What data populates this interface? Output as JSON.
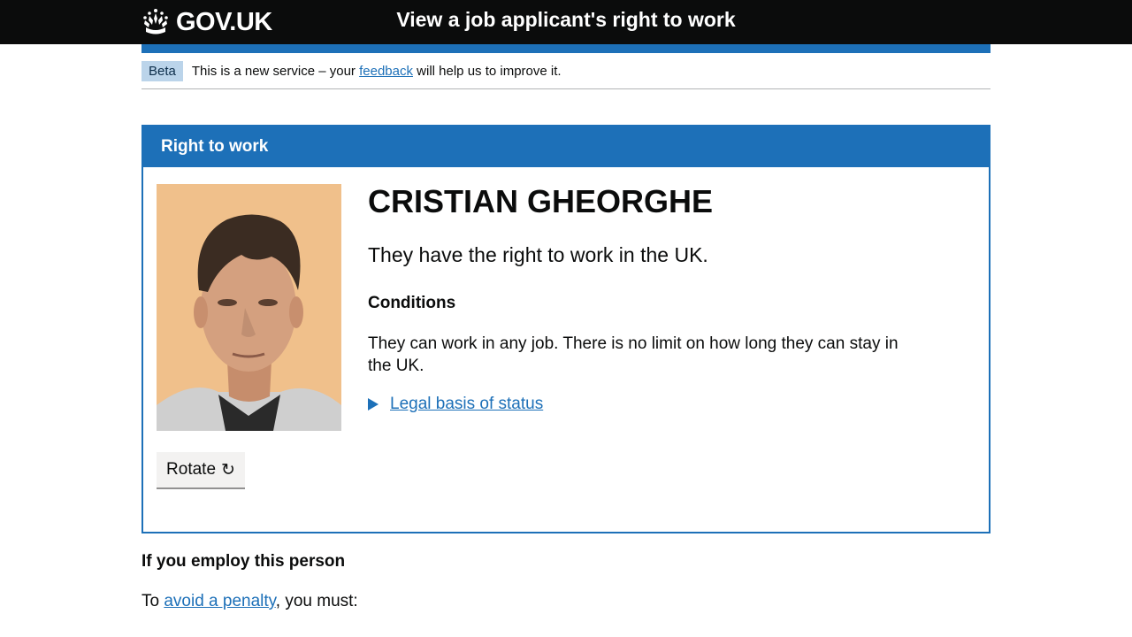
{
  "header": {
    "logo_text": "GOV.UK",
    "service_name": "View a job applicant's right to work"
  },
  "beta_banner": {
    "tag": "Beta",
    "text_before": "This is a new service – your ",
    "link": "feedback",
    "text_after": " will help us to improve it."
  },
  "panel": {
    "title": "Right to work",
    "name": "CRISTIAN GHEORGHE",
    "status": "They have the right to work in the UK.",
    "conditions_heading": "Conditions",
    "conditions_text": "They can work in any job. There is no limit on how long they can stay in the UK.",
    "legal_link": "Legal basis of status",
    "rotate_label": "Rotate",
    "rotate_icon": "↻"
  },
  "employ": {
    "heading": "If you employ this person",
    "text_before": "To ",
    "link": "avoid a penalty",
    "text_after": ", you must:"
  },
  "colors": {
    "brand_blue": "#1d70b8",
    "header_black": "#0b0c0c"
  }
}
